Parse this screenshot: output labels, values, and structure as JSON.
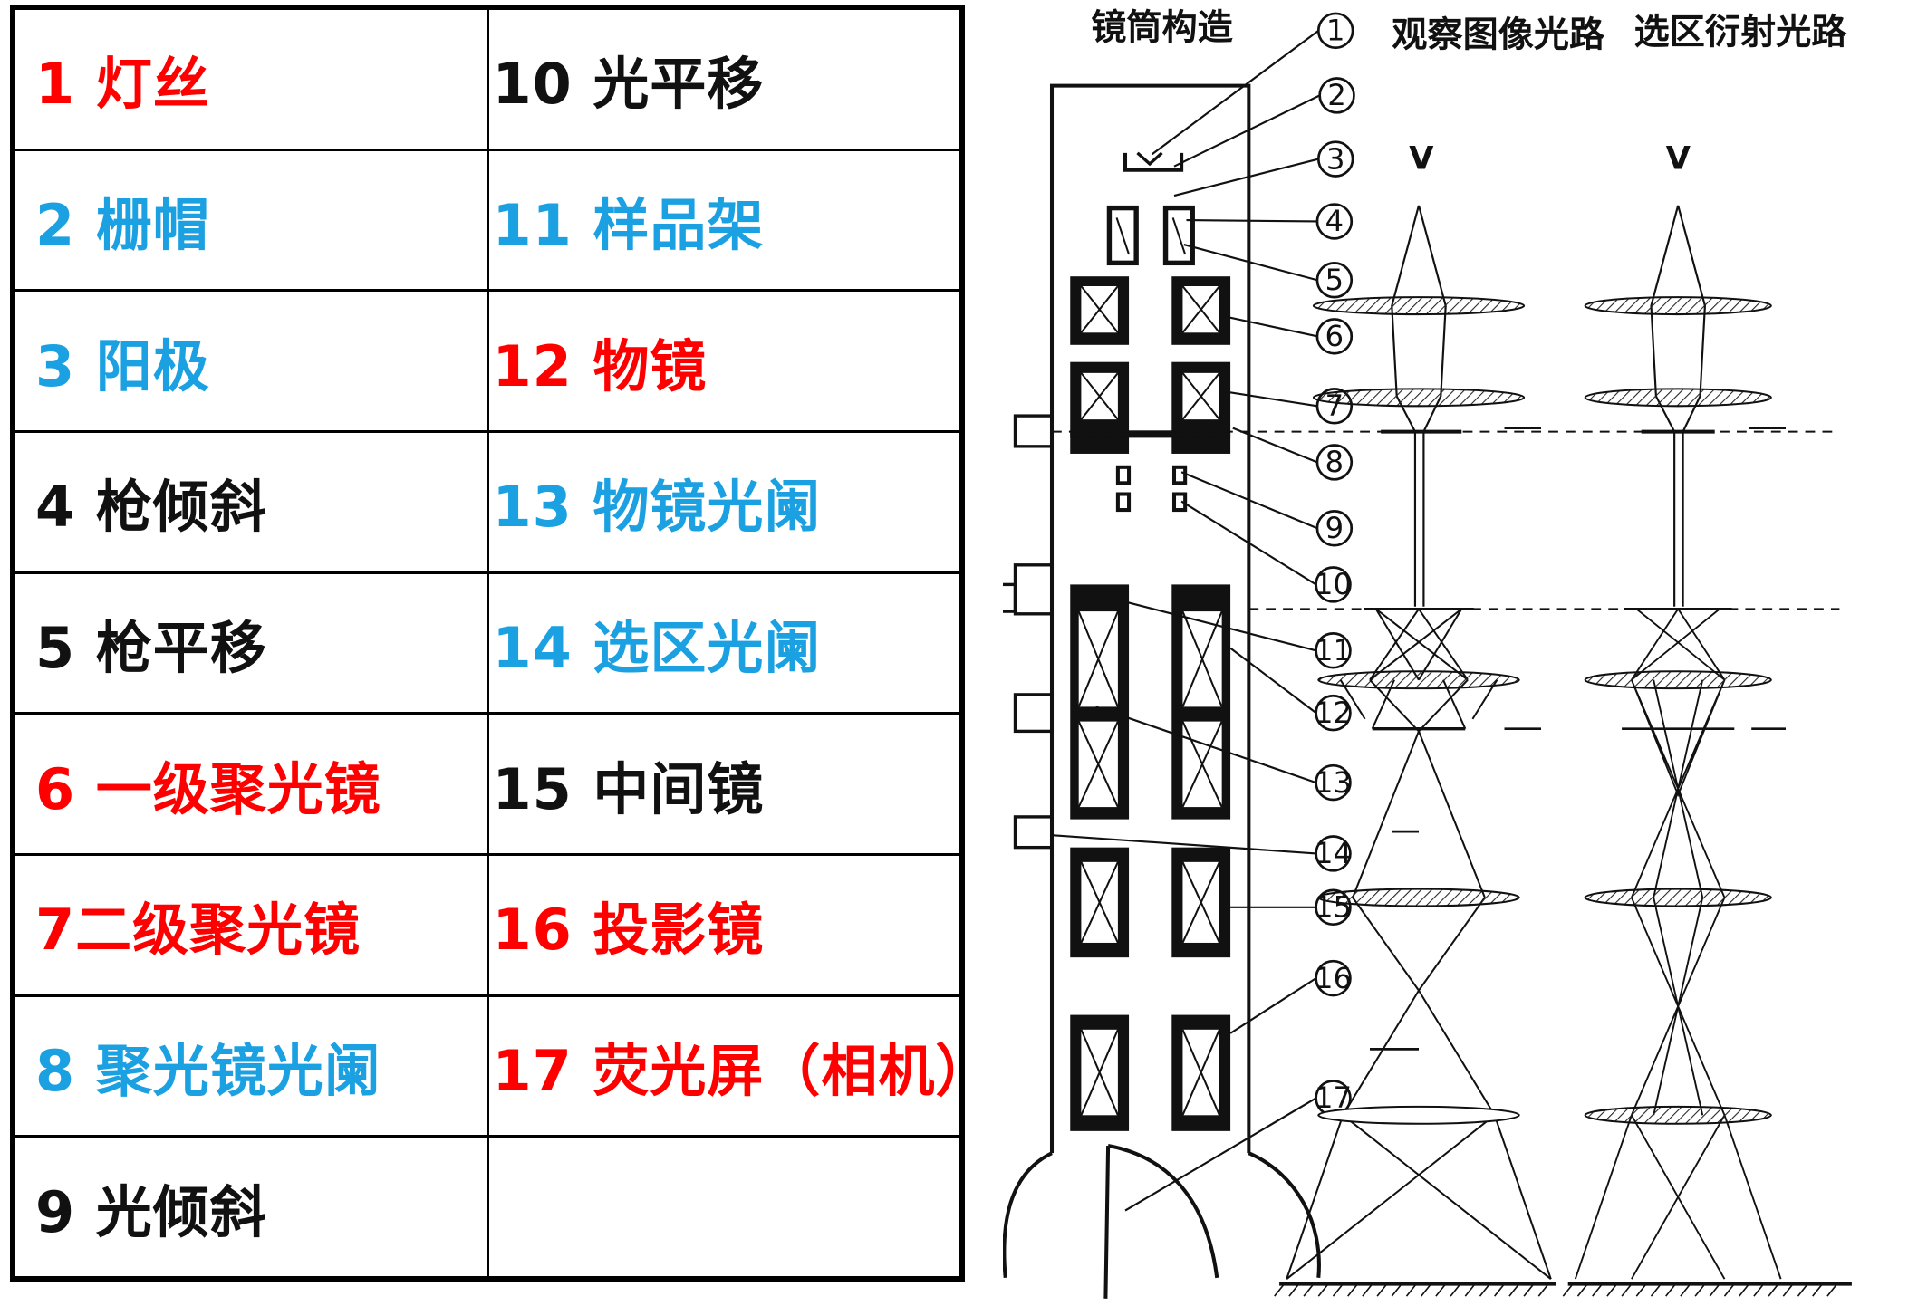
{
  "legend": [
    {
      "id": 1,
      "text": "1 灯丝",
      "color": "#ff0000"
    },
    {
      "id": 2,
      "text": "2 栅帽",
      "color": "#1ba1e2"
    },
    {
      "id": 3,
      "text": "3 阳极",
      "color": "#1ba1e2"
    },
    {
      "id": 4,
      "text": "4 枪倾斜",
      "color": "#111111"
    },
    {
      "id": 5,
      "text": "5 枪平移",
      "color": "#111111"
    },
    {
      "id": 6,
      "text": "6 一级聚光镜",
      "color": "#ff0000"
    },
    {
      "id": 7,
      "text": "7二级聚光镜",
      "color": "#ff0000"
    },
    {
      "id": 8,
      "text": "8 聚光镜光阑",
      "color": "#1ba1e2"
    },
    {
      "id": 9,
      "text": "9 光倾斜",
      "color": "#111111"
    },
    {
      "id": 10,
      "text": "10 光平移",
      "color": "#111111"
    },
    {
      "id": 11,
      "text": "11 样品架",
      "color": "#1ba1e2"
    },
    {
      "id": 12,
      "text": "12 物镜",
      "color": "#ff0000"
    },
    {
      "id": 13,
      "text": "13 物镜光阑",
      "color": "#1ba1e2"
    },
    {
      "id": 14,
      "text": "14 选区光阑",
      "color": "#1ba1e2"
    },
    {
      "id": 15,
      "text": "15 中间镜",
      "color": "#111111"
    },
    {
      "id": 16,
      "text": "16 投影镜",
      "color": "#ff0000"
    },
    {
      "id": 17,
      "text": "17 荧光屏（相机）",
      "color": "#ff0000"
    }
  ],
  "diagram": {
    "headers": {
      "column_structure": "镜筒构造",
      "imaging_path": "观察图像光路",
      "diffraction_path": "选区衍射光路"
    },
    "callouts": [
      "1",
      "2",
      "3",
      "4",
      "5",
      "6",
      "7",
      "8",
      "9",
      "10",
      "11",
      "12",
      "13",
      "14",
      "15",
      "16",
      "17"
    ],
    "gun_label": "V"
  }
}
